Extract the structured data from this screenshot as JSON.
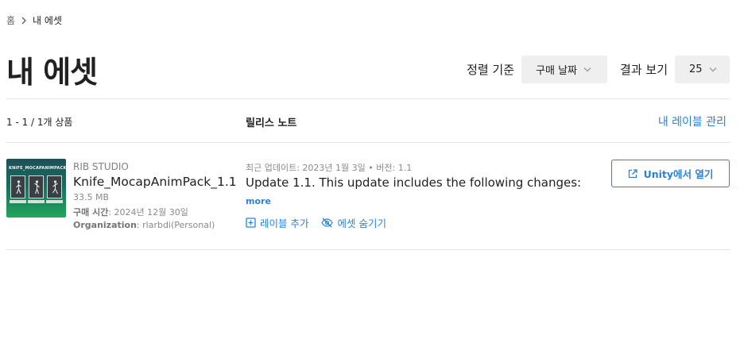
{
  "breadcrumb": {
    "home": "홈",
    "current": "내 에셋"
  },
  "page": {
    "title": "내 에셋"
  },
  "controls": {
    "sort_label": "정렬 기준",
    "sort_value": "구매 날짜",
    "page_size_label": "결과 보기",
    "page_size_value": "25"
  },
  "list_header": {
    "count": "1 - 1 / 1개 상품",
    "release_notes": "릴리스 노트",
    "manage_labels": "내 레이블 관리"
  },
  "assets": [
    {
      "thumbnail_title": "KNIFE_MOCAPANIMPACK",
      "publisher": "RIB STUDIO",
      "name": "Knife_MocapAnimPack_1.1",
      "size": "33.5 MB",
      "purchase_label": "구매 시간",
      "purchase_date": "2024년 12월 30일",
      "org_label": "Organization",
      "org_value": "rlarbdi(Personal)",
      "update_label": "최근 업데이트",
      "update_date": "2023년 1월 3일",
      "version_label": "버전",
      "version": "1.1",
      "release_text": "Update 1.1. This update includes the following changes:",
      "more": "more",
      "add_label": "레이블 추가",
      "hide_asset": "에셋 숨기기",
      "open_button": "Unity에서 열기"
    }
  ],
  "colors": {
    "accent": "#2b82d9",
    "select_bg": "#efefef",
    "divider": "#e4e4e4"
  },
  "icons": [
    "chevron-right-icon",
    "chevron-down-icon",
    "plus-square-icon",
    "eye-off-icon",
    "external-link-icon"
  ]
}
